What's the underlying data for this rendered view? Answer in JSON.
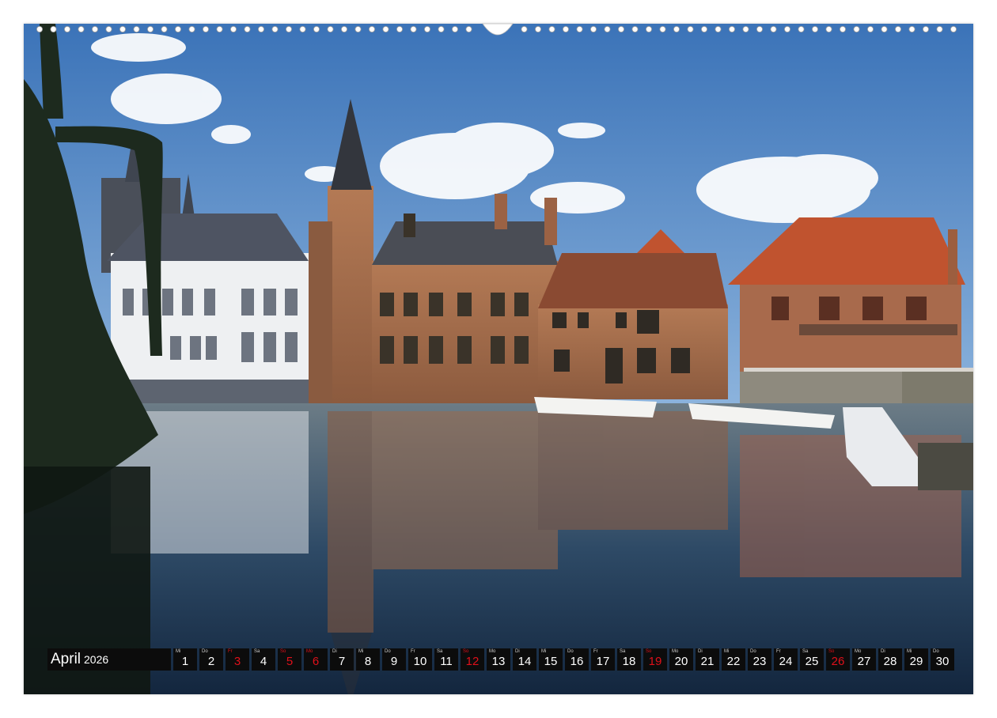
{
  "calendar": {
    "month": "April",
    "year": "2026",
    "days": [
      {
        "abbr": "Mi",
        "num": "1",
        "weekend": false
      },
      {
        "abbr": "Do",
        "num": "2",
        "weekend": false
      },
      {
        "abbr": "Fr",
        "num": "3",
        "weekend": true
      },
      {
        "abbr": "Sa",
        "num": "4",
        "weekend": false
      },
      {
        "abbr": "So",
        "num": "5",
        "weekend": true
      },
      {
        "abbr": "Mo",
        "num": "6",
        "weekend": true
      },
      {
        "abbr": "Di",
        "num": "7",
        "weekend": false
      },
      {
        "abbr": "Mi",
        "num": "8",
        "weekend": false
      },
      {
        "abbr": "Do",
        "num": "9",
        "weekend": false
      },
      {
        "abbr": "Fr",
        "num": "10",
        "weekend": false
      },
      {
        "abbr": "Sa",
        "num": "11",
        "weekend": false
      },
      {
        "abbr": "So",
        "num": "12",
        "weekend": true
      },
      {
        "abbr": "Mo",
        "num": "13",
        "weekend": false
      },
      {
        "abbr": "Di",
        "num": "14",
        "weekend": false
      },
      {
        "abbr": "Mi",
        "num": "15",
        "weekend": false
      },
      {
        "abbr": "Do",
        "num": "16",
        "weekend": false
      },
      {
        "abbr": "Fr",
        "num": "17",
        "weekend": false
      },
      {
        "abbr": "Sa",
        "num": "18",
        "weekend": false
      },
      {
        "abbr": "So",
        "num": "19",
        "weekend": true
      },
      {
        "abbr": "Mo",
        "num": "20",
        "weekend": false
      },
      {
        "abbr": "Di",
        "num": "21",
        "weekend": false
      },
      {
        "abbr": "Mi",
        "num": "22",
        "weekend": false
      },
      {
        "abbr": "Do",
        "num": "23",
        "weekend": false
      },
      {
        "abbr": "Fr",
        "num": "24",
        "weekend": false
      },
      {
        "abbr": "Sa",
        "num": "25",
        "weekend": false
      },
      {
        "abbr": "So",
        "num": "26",
        "weekend": true
      },
      {
        "abbr": "Mo",
        "num": "27",
        "weekend": false
      },
      {
        "abbr": "Di",
        "num": "28",
        "weekend": false
      },
      {
        "abbr": "Mi",
        "num": "29",
        "weekend": false
      },
      {
        "abbr": "Do",
        "num": "30",
        "weekend": false
      }
    ]
  },
  "colors": {
    "sky": "#4f86c6",
    "water": "#27415e",
    "brick": "#a0684a",
    "roof": "#c0532f",
    "weekend_red": "#e0101a",
    "bar_black": "#0c0c0c"
  }
}
